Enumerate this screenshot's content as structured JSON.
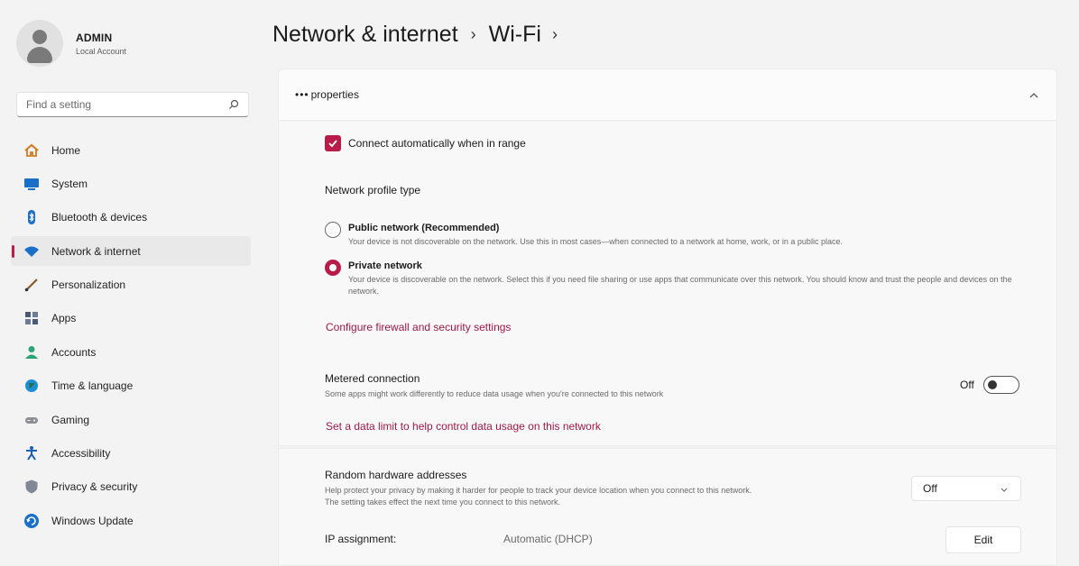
{
  "user": {
    "name": "ADMIN",
    "account_type": "Local Account"
  },
  "search": {
    "placeholder": "Find a setting",
    "icon": "search-icon"
  },
  "sidebar": {
    "items": [
      {
        "label": "Home",
        "icon": "home-icon"
      },
      {
        "label": "System",
        "icon": "system-icon"
      },
      {
        "label": "Bluetooth & devices",
        "icon": "bluetooth-icon"
      },
      {
        "label": "Network & internet",
        "icon": "wifi-icon",
        "active": true
      },
      {
        "label": "Personalization",
        "icon": "brush-icon"
      },
      {
        "label": "Apps",
        "icon": "apps-icon"
      },
      {
        "label": "Accounts",
        "icon": "accounts-icon"
      },
      {
        "label": "Time & language",
        "icon": "globe-icon"
      },
      {
        "label": "Gaming",
        "icon": "gamepad-icon"
      },
      {
        "label": "Accessibility",
        "icon": "accessibility-icon"
      },
      {
        "label": "Privacy & security",
        "icon": "shield-icon"
      },
      {
        "label": "Windows Update",
        "icon": "update-icon"
      }
    ]
  },
  "breadcrumb": {
    "parent": "Network & internet",
    "current": "Wi-Fi"
  },
  "panel": {
    "title": "properties",
    "connect_auto": {
      "label": "Connect automatically when in range",
      "checked": true
    },
    "profile_type_label": "Network profile type",
    "public": {
      "title": "Public network (Recommended)",
      "description": "Your device is not discoverable on the network. Use this in most cases—when connected to a network at home, work, or in a public place.",
      "selected": false
    },
    "private": {
      "title": "Private network",
      "description": "Your device is discoverable on the network. Select this if you need file sharing or use apps that communicate over this network. You should know and trust the people and devices on the network.",
      "selected": true
    },
    "firewall_link": "Configure firewall and security settings",
    "metered": {
      "title": "Metered connection",
      "description": "Some apps might work differently to reduce data usage when you're connected to this network",
      "state_label": "Off"
    },
    "data_limit_link": "Set a data limit to help control data usage on this network"
  },
  "random_hw": {
    "title": "Random hardware addresses",
    "description_line1": "Help protect your privacy by making it harder for people to track your device location when you connect to this network.",
    "description_line2": "The setting takes effect the next time you connect to this network.",
    "value": "Off"
  },
  "ip": {
    "label": "IP assignment:",
    "value": "Automatic (DHCP)",
    "edit_label": "Edit"
  },
  "colors": {
    "accent": "#b81d4a",
    "link": "#9b1a44"
  }
}
